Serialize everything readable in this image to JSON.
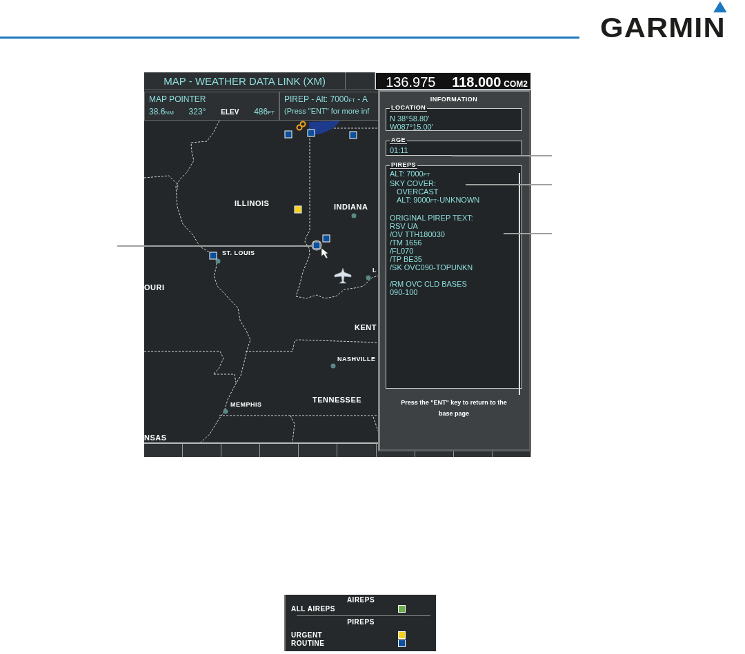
{
  "header": {
    "logo": "GARMIN"
  },
  "display": {
    "title": "MAP - WEATHER DATA LINK (XM)",
    "frequencies": {
      "active": "136.975",
      "standby": "118.000",
      "radio": "COM2"
    },
    "map_pointer": {
      "label": "MAP POINTER",
      "distance": {
        "value": "38.6",
        "unit": "NM"
      },
      "bearing": "323°",
      "elev_label": "ELEV",
      "elevation": {
        "value": "486",
        "unit": "FT"
      }
    },
    "pirep_summary": {
      "line_1": {
        "text": "PIREP - Alt: 7000",
        "unit": "FT",
        "after": " - A"
      },
      "line_2": {
        "text": "(Press \"ENT\" for more inf"
      }
    },
    "map": {
      "labels": [
        {
          "text": "ILLINOIS",
          "kind": "state"
        },
        {
          "text": "INDIANA",
          "kind": "state"
        },
        {
          "text": "ST. LOUIS",
          "kind": "city"
        },
        {
          "text": "OURI",
          "kind": "state"
        },
        {
          "text": "L",
          "kind": "city"
        },
        {
          "text": "KENT",
          "kind": "state"
        },
        {
          "text": "NASHVILLE",
          "kind": "city"
        },
        {
          "text": "TENNESSEE",
          "kind": "state"
        },
        {
          "text": "MEMPHIS",
          "kind": "city"
        },
        {
          "text": "NSAS",
          "kind": "state"
        }
      ],
      "markers": [
        {
          "color": "#0b4f9e",
          "selected": false
        },
        {
          "color": "#0b4f9e",
          "selected": false
        },
        {
          "color": "#0b4f9e",
          "selected": false
        },
        {
          "color": "#f5d21d",
          "selected": false
        },
        {
          "color": "#0b4f9e",
          "selected": false
        },
        {
          "color": "#0b4f9e",
          "selected": true
        },
        {
          "color": "#0b4f9e",
          "selected": false
        }
      ]
    },
    "information": {
      "title": "INFORMATION",
      "location": {
        "label": "LOCATION",
        "lines": [
          "N 38°58.80'",
          "W087°15.00'"
        ]
      },
      "age": {
        "label": "AGE",
        "value": "01:11"
      },
      "pireps": {
        "label": "PIREPS",
        "sections": [
          {
            "lines": [
              {
                "text": "ALT: 7000",
                "unit": "FT"
              },
              {
                "text": "SKY COVER:",
                "children": [
                  {
                    "text": "OVERCAST"
                  },
                  {
                    "text": "ALT: 9000",
                    "unit": "FT",
                    "after": "-UNKNOWN"
                  }
                ]
              }
            ]
          },
          {
            "lines": [
              {
                "text": "ORIGINAL PIREP TEXT:"
              },
              {
                "text": "RSV UA"
              },
              {
                "text": "/OV TTH180030"
              },
              {
                "text": "/TM 1656"
              },
              {
                "text": "/FL070"
              },
              {
                "text": "/TP BE35"
              },
              {
                "text": "/SK OVC090-TOPUNKN"
              }
            ]
          },
          {
            "lines": [
              {
                "text": "/RM OVC CLD BASES"
              },
              {
                "text": "090-100"
              }
            ]
          }
        ]
      },
      "footer": "Press the \"ENT\" key to return to the base page"
    }
  },
  "legend": {
    "sections": [
      {
        "title": "AIREPS",
        "items": [
          {
            "label": "ALL AIREPS",
            "color": "#6ab04c"
          }
        ]
      },
      {
        "title": "PIREPS",
        "items": [
          {
            "label": "URGENT",
            "color": "#f5d21d"
          },
          {
            "label": "ROUTINE",
            "color": "#0b4f9e"
          }
        ]
      }
    ]
  }
}
